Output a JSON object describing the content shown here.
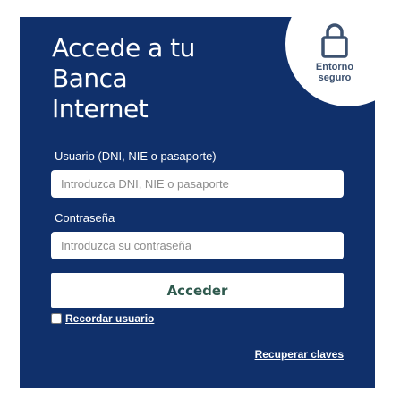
{
  "header": {
    "title_lines": [
      "Accede a tu",
      "Banca",
      "Internet"
    ]
  },
  "secure_badge": {
    "icon": "lock-icon",
    "line1": "Entorno",
    "line2": "seguro"
  },
  "form": {
    "user_label": "Usuario (DNI, NIE o pasaporte)",
    "user_placeholder": "Introduzca DNI, NIE o pasaporte",
    "user_value": "",
    "password_label": "Contraseña",
    "password_placeholder": "Introduzca su contraseña",
    "password_value": "",
    "submit_label": "Acceder",
    "remember_label": "Recordar usuario",
    "remember_checked": false,
    "recover_label": "Recuperar claves"
  },
  "colors": {
    "panel_background": "#10306b",
    "button_text": "#2f5a4e",
    "badge_text": "#3d5270"
  }
}
